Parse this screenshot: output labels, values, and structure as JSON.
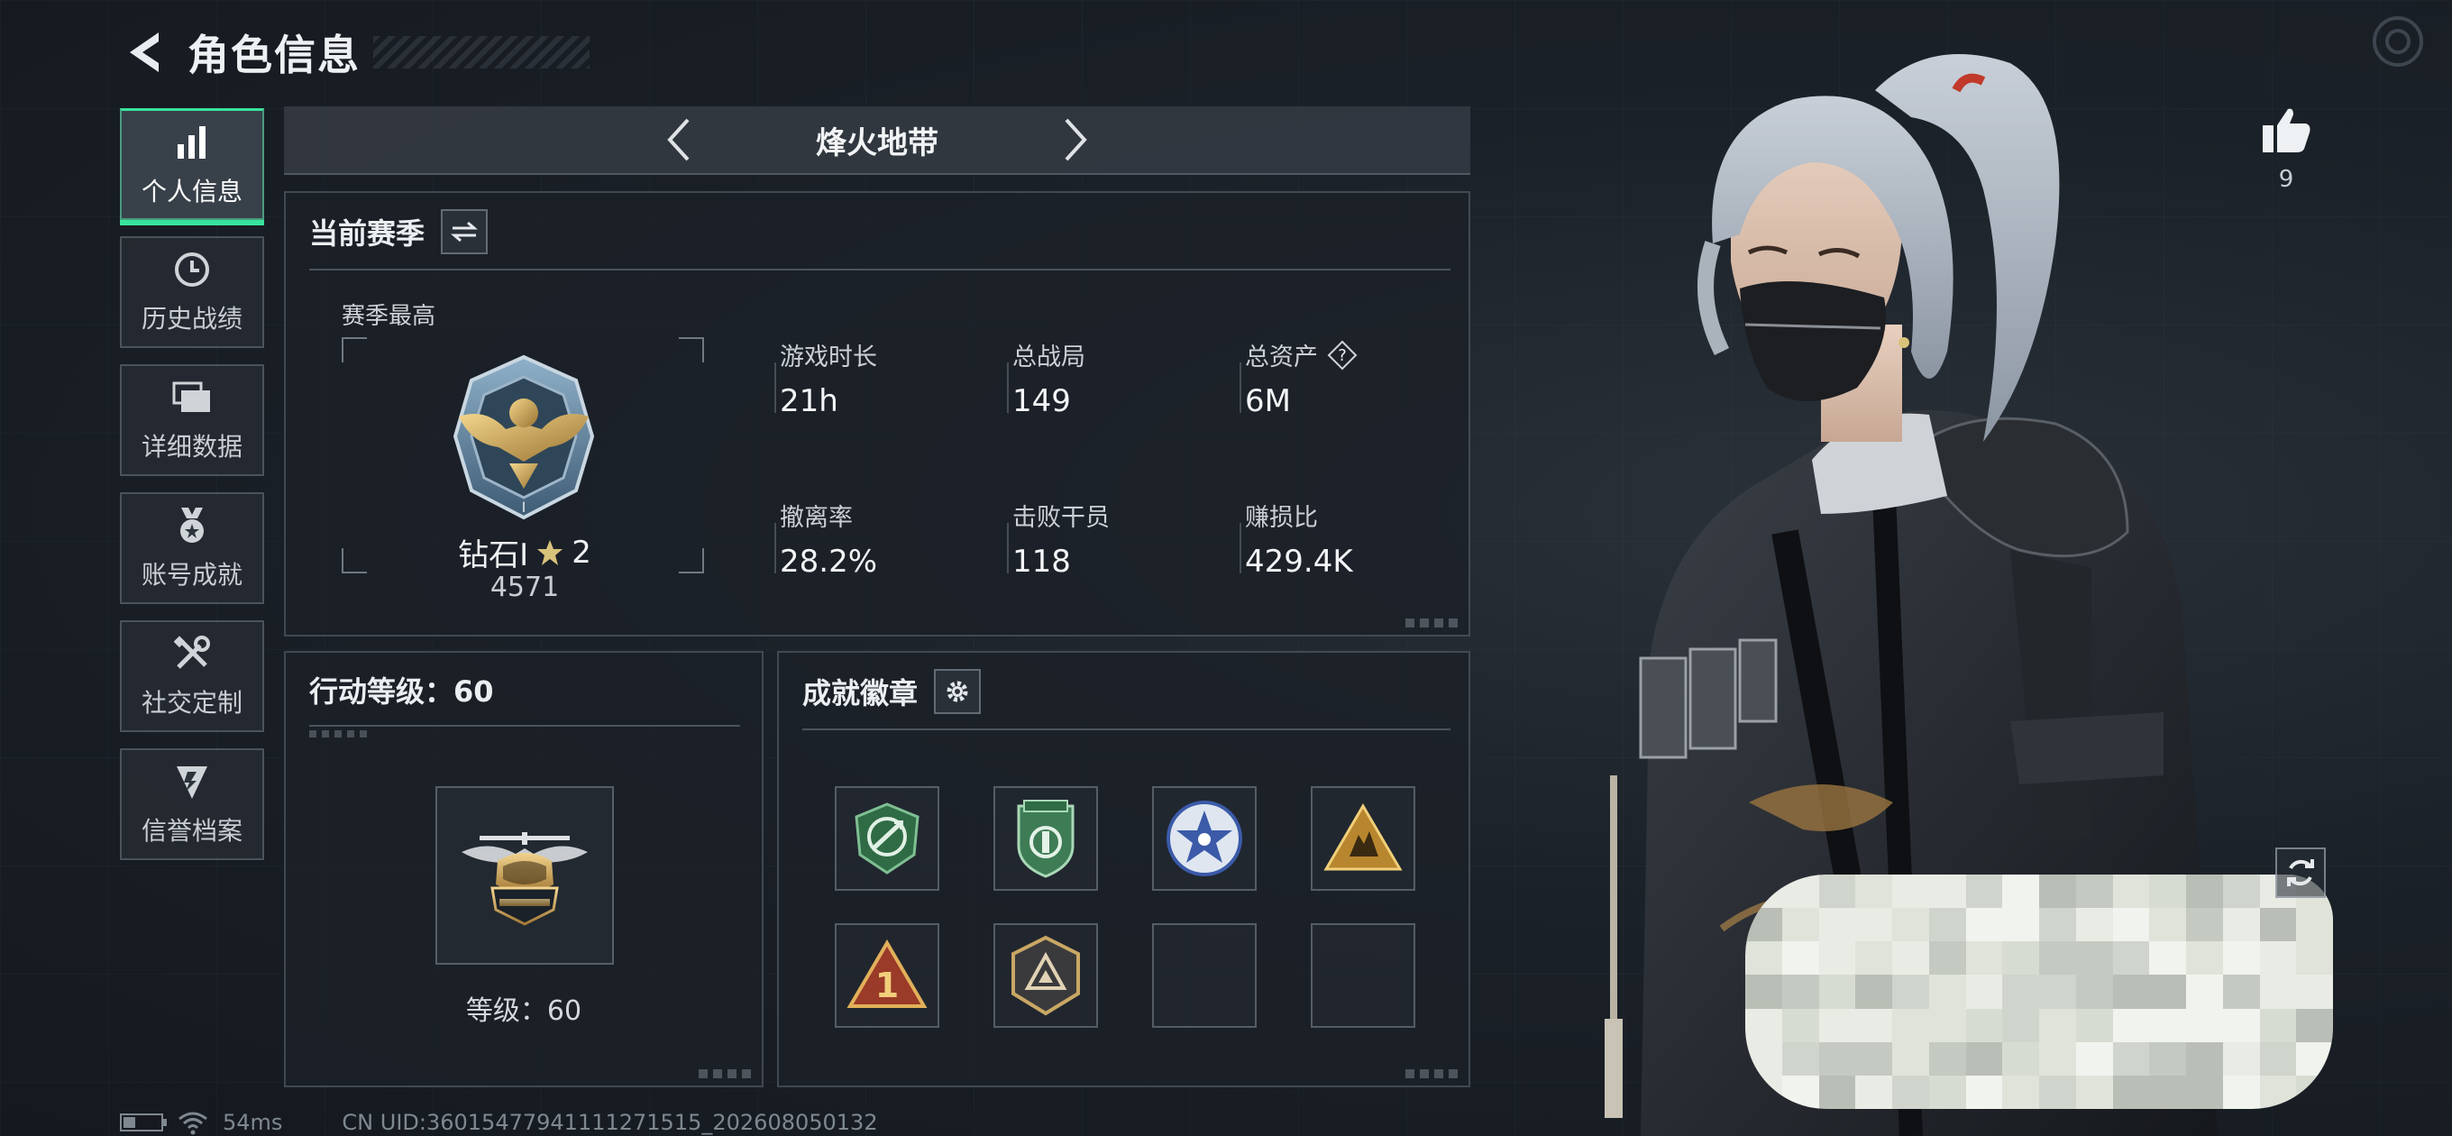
{
  "header": {
    "title": "角色信息"
  },
  "sidebar": {
    "items": [
      {
        "label": "个人信息",
        "icon": "bar-chart-icon",
        "active": true
      },
      {
        "label": "历史战绩",
        "icon": "clock-icon",
        "active": false
      },
      {
        "label": "详细数据",
        "icon": "folders-icon",
        "active": false
      },
      {
        "label": "账号成就",
        "icon": "medal-icon",
        "active": false
      },
      {
        "label": "社交定制",
        "icon": "tools-icon",
        "active": false
      },
      {
        "label": "信誉档案",
        "icon": "shield-credit-icon",
        "active": false
      }
    ]
  },
  "mode": {
    "name": "烽火地带"
  },
  "season": {
    "title": "当前赛季",
    "best_label": "赛季最高",
    "rank_name": "钻石Ⅰ",
    "rank_stars": "2",
    "rank_score": "4571",
    "stats": [
      {
        "label": "游戏时长",
        "value": "21h"
      },
      {
        "label": "总战局",
        "value": "149"
      },
      {
        "label": "总资产",
        "value": "6M",
        "help": "?"
      },
      {
        "label": "撤离率",
        "value": "28.2%"
      },
      {
        "label": "击败干员",
        "value": "118"
      },
      {
        "label": "赚损比",
        "value": "429.4K"
      }
    ]
  },
  "level": {
    "title": "行动等级：60",
    "level_text": "等级：60"
  },
  "achievements": {
    "title": "成就徽章",
    "badges": [
      {
        "icon": "green-arrows-badge-icon",
        "filled": true
      },
      {
        "icon": "green-shield-badge-icon",
        "filled": true
      },
      {
        "icon": "blue-star-badge-icon",
        "filled": true
      },
      {
        "icon": "gold-triangle-badge-icon",
        "filled": true
      },
      {
        "icon": "red-triangle-number-one-badge-icon",
        "filled": true
      },
      {
        "icon": "hexagon-triangle-badge-icon",
        "filled": true
      },
      {
        "icon": "empty-badge-slot",
        "filled": false
      },
      {
        "icon": "empty-badge-slot",
        "filled": false
      }
    ]
  },
  "character": {
    "likes": "9"
  },
  "footer": {
    "ping": "54ms",
    "uid": "CN UID:3601547794111127151​5_202608050132"
  },
  "colors": {
    "accent": "#38e39d",
    "panel_border": "#8c96a0",
    "text": "#e6e9ec"
  }
}
